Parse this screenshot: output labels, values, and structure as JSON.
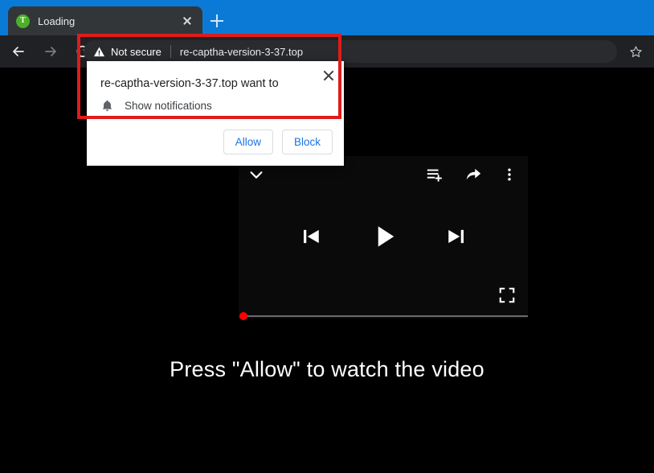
{
  "browser": {
    "tab": {
      "favicon_letter": "T",
      "favicon_color": "#4caf28",
      "title": "Loading",
      "close_icon": "close-icon"
    },
    "new_tab_icon": "plus-icon",
    "nav": {
      "back_icon": "arrow-left-icon",
      "forward_icon": "arrow-right-icon",
      "reload_icon": "reload-icon"
    },
    "omnibox": {
      "security_icon": "warning-triangle-icon",
      "security_label": "Not secure",
      "url": "re-captha-version-3-37.top",
      "bookmark_icon": "star-icon"
    },
    "colors": {
      "titlebar": "#0b7ad6",
      "toolbar": "#202124",
      "tab_active": "#323639",
      "omnibox": "#292b2e"
    }
  },
  "permission_dialog": {
    "title": "re-captha-version-3-37.top want to",
    "permission_icon": "bell-icon",
    "permission_label": "Show notifications",
    "close_icon": "close-icon",
    "allow_label": "Allow",
    "block_label": "Block",
    "button_text_color": "#1a73e8"
  },
  "annotation": {
    "highlight_color": "#e01b1b",
    "shape": "rectangle"
  },
  "page": {
    "background_color": "#000000",
    "tagline": "Press \"Allow\" to watch the video",
    "video_player": {
      "background_color": "#0a0a0a",
      "collapse_icon": "chevron-down-icon",
      "add_to_queue_icon": "add-to-queue-icon",
      "share_icon": "share-icon",
      "more_icon": "kebab-menu-icon",
      "previous_icon": "skip-previous-icon",
      "play_icon": "play-icon",
      "next_icon": "skip-next-icon",
      "fullscreen_icon": "fullscreen-icon",
      "progress_percent": 0,
      "scrubber_color": "#ff0000",
      "track_color": "#6b6b6b"
    }
  }
}
